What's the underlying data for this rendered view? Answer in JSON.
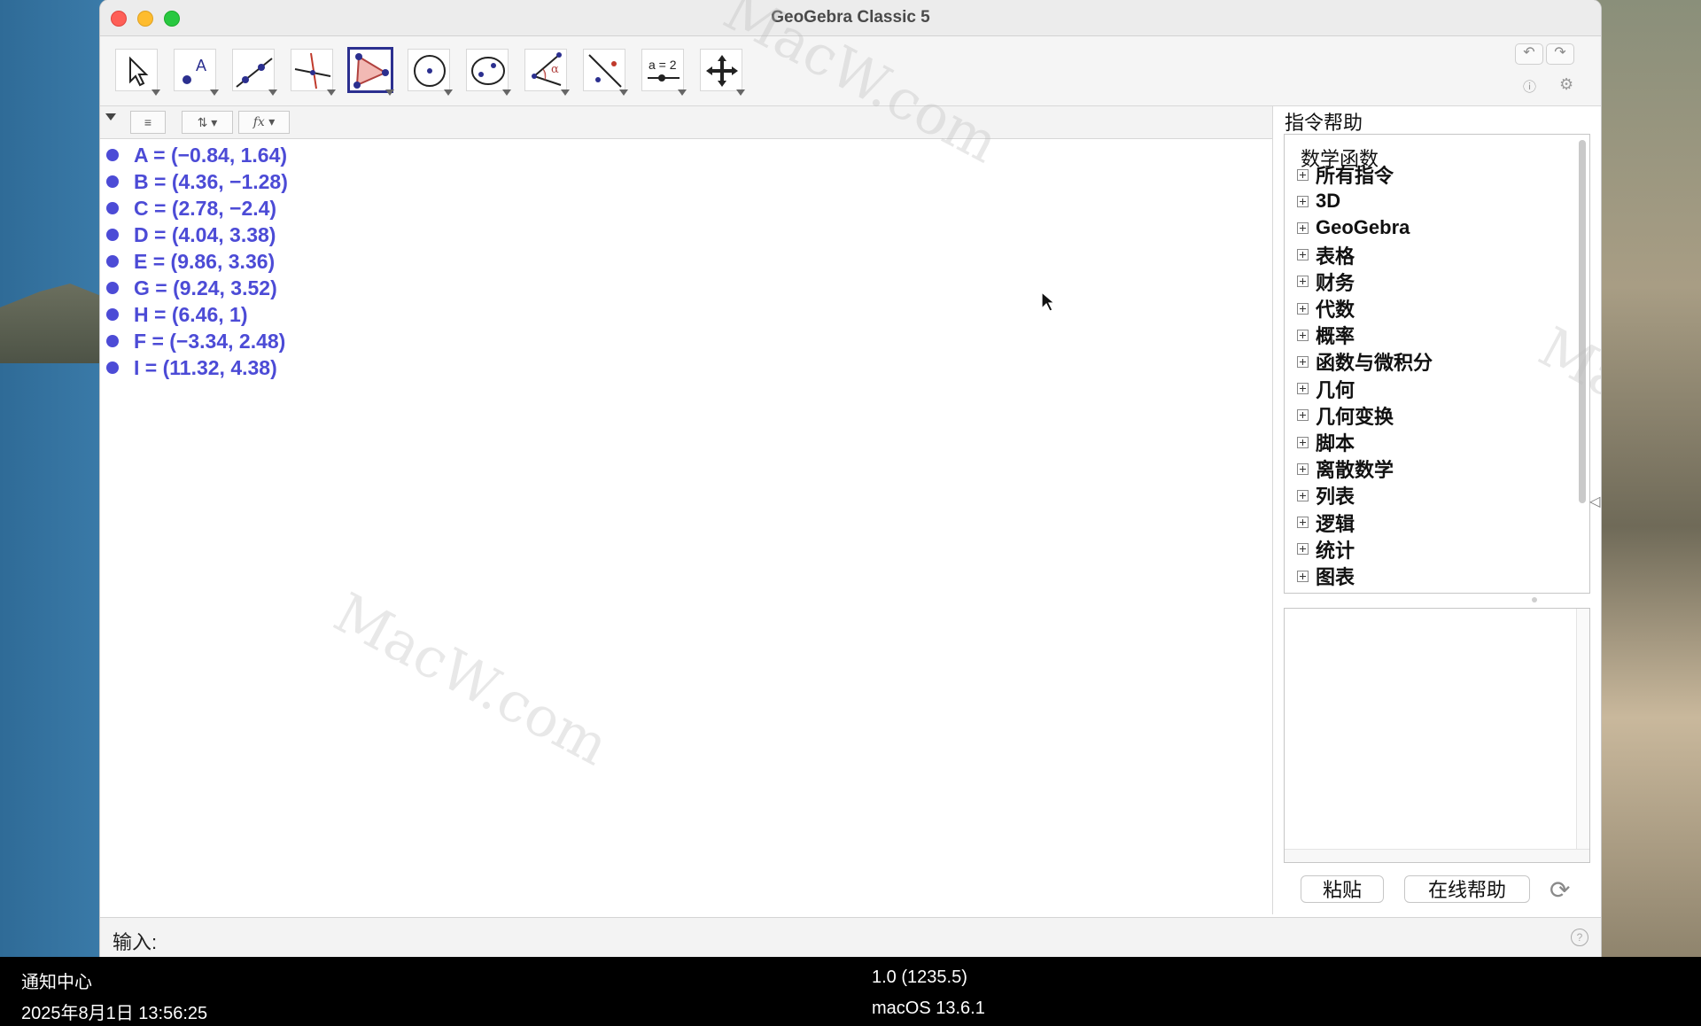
{
  "window": {
    "title": "GeoGebra Classic 5"
  },
  "toolbar": {
    "tools": [
      {
        "name": "move-tool",
        "icon": "arrow-cursor-icon"
      },
      {
        "name": "point-tool",
        "icon": "point-icon"
      },
      {
        "name": "line-tool",
        "icon": "line-icon"
      },
      {
        "name": "perpendicular-line-tool",
        "icon": "perpendicular-icon"
      },
      {
        "name": "polygon-tool",
        "icon": "polygon-icon",
        "active": true
      },
      {
        "name": "circle-tool",
        "icon": "circle-icon"
      },
      {
        "name": "ellipse-tool",
        "icon": "ellipse-icon"
      },
      {
        "name": "angle-tool",
        "icon": "angle-icon",
        "label": "α"
      },
      {
        "name": "reflect-tool",
        "icon": "reflect-icon"
      },
      {
        "name": "slider-tool",
        "icon": "slider-icon",
        "label": "a = 2"
      },
      {
        "name": "move-graphics-tool",
        "icon": "move-arrows-icon"
      }
    ],
    "undo_icon": "undo-icon",
    "redo_icon": "redo-icon",
    "help_icon": "help-icon",
    "settings_icon": "gear-icon"
  },
  "algebra": {
    "header_fx": "fx",
    "items": [
      "A = (−0.84, 1.64)",
      "B = (4.36, −1.28)",
      "C = (2.78, −2.4)",
      "D = (4.04, 3.38)",
      "E = (9.86, 3.36)",
      "G = (9.24, 3.52)",
      "H = (6.46, 1)",
      "F = (−3.34, 2.48)",
      "I = (11.32, 4.38)"
    ]
  },
  "help": {
    "title": "指令帮助",
    "root": "数学函数",
    "items": [
      "所有指令",
      "3D",
      "GeoGebra",
      "表格",
      "财务",
      "代数",
      "概率",
      "函数与微积分",
      "几何",
      "几何变换",
      "脚本",
      "离散数学",
      "列表",
      "逻辑",
      "统计",
      "图表"
    ],
    "paste_label": "粘贴",
    "online_help_label": "在线帮助",
    "refresh_icon": "refresh-icon"
  },
  "input": {
    "label": "输入:",
    "value": "",
    "help_icon": "help-icon"
  },
  "watermark": "MacW.com",
  "status": {
    "left_title": "通知中心",
    "left_time": "2025年8月1日 13:56:25",
    "center_version": "1.0 (1235.5)",
    "center_os": "macOS 13.6.1"
  }
}
